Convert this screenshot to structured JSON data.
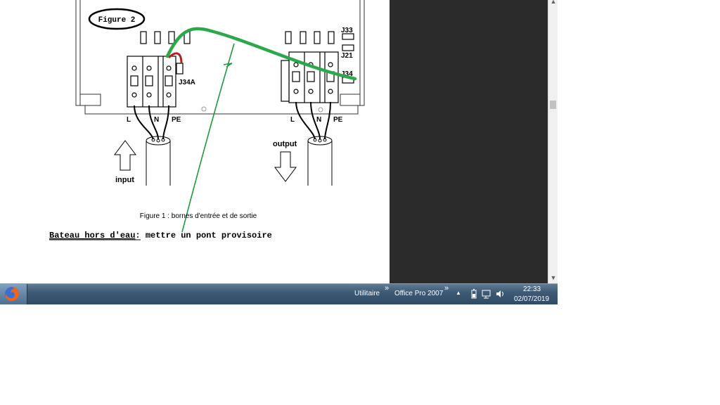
{
  "document": {
    "figure2_label": "Figure 2",
    "terminals": {
      "j33": "J33",
      "j21": "J21",
      "j34": "J34",
      "j34a": "J34A",
      "input_l": "L",
      "input_n": "N",
      "input_pe": "PE",
      "output_l": "L",
      "output_n": "N",
      "output_pe": "PE"
    },
    "input_label": "input",
    "output_label": "output",
    "figure1_caption": "Figure 1 : bornes d'entrée et de sortie",
    "note_underlined": "Bateau hors d'eau",
    "note_rest": ": mettre un pont provisoire",
    "wire_color": "#2aa84a"
  },
  "taskbar": {
    "toolbar1": "Utilitaire",
    "toolbar2": "Office Pro 2007",
    "chevron": "»",
    "tray_up": "▲",
    "time": "22:33",
    "date": "02/07/2019"
  },
  "scrollbar": {
    "up_arrow": "▲",
    "down_arrow": "▼"
  }
}
